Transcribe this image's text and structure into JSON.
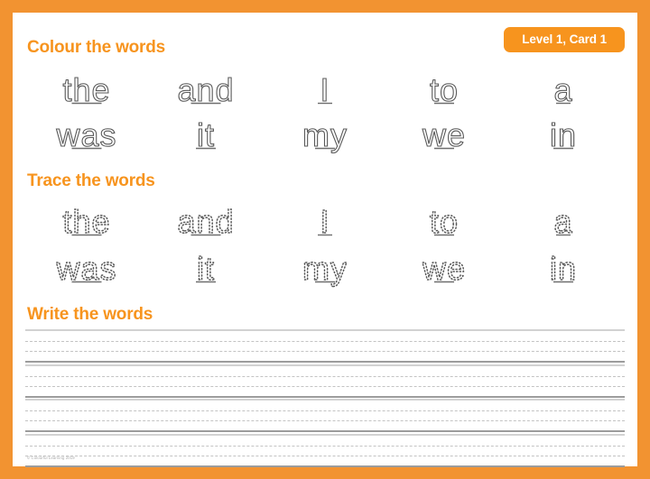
{
  "theme": {
    "border_color": "#F29331",
    "accent_color": "#F7941E",
    "badge_text_color": "#FFFFFF",
    "page_background": "#FFFFFF",
    "word_outline_color": "#595959",
    "rule_solid_color": "#9C9C9C",
    "rule_dash_color": "#C3C3C3"
  },
  "badge": {
    "label": "Level 1, Card 1"
  },
  "sections": [
    {
      "id": "colour",
      "heading": "Colour the words",
      "style": "outline",
      "rows": [
        [
          "the",
          "and",
          "I",
          "to",
          "a"
        ],
        [
          "was",
          "it",
          "my",
          "we",
          "in"
        ]
      ]
    },
    {
      "id": "trace",
      "heading": "Trace the words",
      "style": "dotted",
      "rows": [
        [
          "the",
          "and",
          "I",
          "to",
          "a"
        ],
        [
          "was",
          "it",
          "my",
          "we",
          "in"
        ]
      ]
    },
    {
      "id": "write",
      "heading": "Write the words",
      "style": "lines",
      "line_count": 4
    }
  ],
  "footer": {
    "copyright": "© Colourful Learning 2019"
  }
}
